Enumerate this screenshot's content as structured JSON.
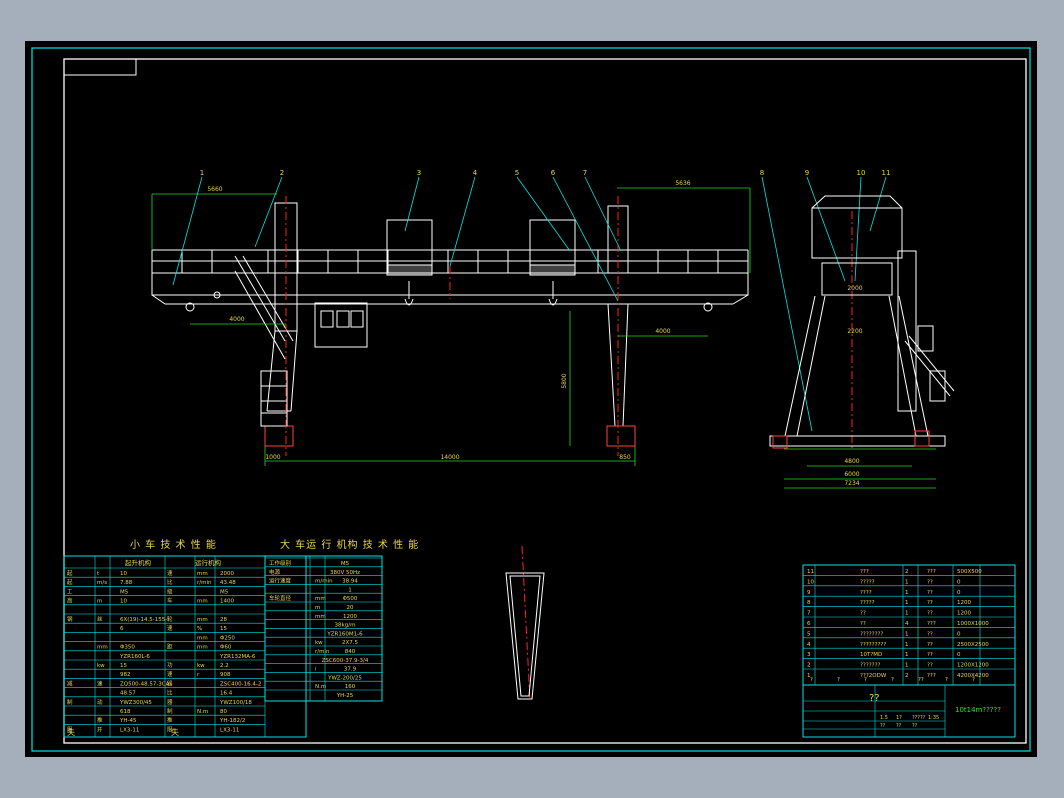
{
  "colors": {
    "background": "#a5aebb",
    "sheet": "#000000",
    "line_cyan": "#00e5e5",
    "structure": "#ffffff",
    "center_line": "#ff2020",
    "text_yellow": "#e8d44a",
    "text_green": "#33e033",
    "dim_green": "#22dd22"
  },
  "balloons": [
    "1",
    "2",
    "3",
    "4",
    "5",
    "6",
    "7",
    "8",
    "9",
    "10",
    "11"
  ],
  "dimensions": {
    "left_overhang": "5660",
    "right_overhang": "5636",
    "hook_left": "4000",
    "hook_right": "4000",
    "lift_height": "5800",
    "span": "14000",
    "leg_left": "1000",
    "leg_right": "850",
    "trolley_gauge": "2000",
    "side_width_inner": "2200",
    "side_4800": "4800",
    "side_6000": "6000",
    "side_total": "7234"
  },
  "table_titles": {
    "trolley": "小 车 技 术 性 能",
    "crane": "大 车运 行 机构 技 术 性 能"
  },
  "trolley_table": {
    "header": [
      "起升机构",
      "运行机构"
    ],
    "rows": [
      [
        "起",
        "t",
        "10",
        "速",
        "mm",
        "2000"
      ],
      [
        "起",
        "m/s",
        "7.88",
        "比",
        "r/min",
        "43.48"
      ],
      [
        "工",
        "",
        "M5",
        "级",
        "",
        "M5"
      ],
      [
        "高",
        "m",
        "10",
        "车",
        "mm",
        "1400"
      ],
      [
        "",
        "",
        "",
        "",
        "",
        ""
      ],
      [
        "钢",
        "丝",
        "6X(19)-14.5-155-Ⅰ",
        "轮",
        "mm",
        "28"
      ],
      [
        "",
        "",
        "6",
        "速",
        "%",
        "15"
      ],
      [
        "",
        "",
        "",
        "",
        "mm",
        "Φ250"
      ],
      [
        "",
        "mm",
        "Φ350",
        "距",
        "mm",
        "Φ60"
      ],
      [
        "",
        "",
        "YZR160L-6",
        "",
        "",
        "YZR132MA-6"
      ],
      [
        "",
        "kw",
        "15",
        "功",
        "kw",
        "2.2"
      ],
      [
        "",
        "",
        "982",
        "速",
        "r",
        "908"
      ],
      [
        "减",
        "速",
        "ZQ500-48.57-3CA",
        "器",
        "",
        "ZSC400-16.4-2"
      ],
      [
        "",
        "",
        "48.57",
        "比",
        "",
        "16.4"
      ],
      [
        "制",
        "动",
        "YWZ300/45",
        "器",
        "",
        "YWZ100/18"
      ],
      [
        "",
        "",
        "618",
        "制",
        "N.m",
        "80"
      ],
      [
        "",
        "推",
        "YH-45",
        "推",
        "",
        "YH-182/2"
      ],
      [
        "限",
        "开",
        "LX3-11",
        "限",
        "",
        "LX3-11"
      ]
    ]
  },
  "crane_table": {
    "rows": [
      [
        "工作级别",
        "M5"
      ],
      [
        "电源",
        "380V 50Hz"
      ],
      [
        "运行速度",
        "m/min",
        "38.94"
      ],
      [
        "",
        "",
        "1"
      ],
      [
        "车轮直径",
        "mm",
        "Φ500"
      ],
      [
        "",
        "m",
        "20"
      ],
      [
        "",
        "mm",
        "1200"
      ],
      [
        "",
        "38kg/m"
      ],
      [
        "",
        "YZR160M1-6"
      ],
      [
        "",
        "kw",
        "2X7.5"
      ],
      [
        "",
        "r/min",
        "840"
      ],
      [
        "",
        "ZSC600-37.9-3/4"
      ],
      [
        "",
        "i",
        "37.9"
      ],
      [
        "",
        "YWZ-200/25"
      ],
      [
        "",
        "N.m",
        "160"
      ],
      [
        "",
        "YH-25"
      ]
    ]
  },
  "parts_list": [
    [
      "11",
      "???",
      "2",
      "???",
      "500X500"
    ],
    [
      "10",
      "?????",
      "1",
      "??",
      "0"
    ],
    [
      "9",
      "????",
      "1",
      "??",
      "0"
    ],
    [
      "8",
      "?????",
      "1",
      "??",
      "1200"
    ],
    [
      "7",
      "??",
      "1",
      "??",
      "1200"
    ],
    [
      "6",
      "??",
      "4",
      "???",
      "1000X1000"
    ],
    [
      "5",
      "????????",
      "1",
      "??",
      "0"
    ],
    [
      "4",
      "?????????",
      "1",
      "??",
      "2500X2500"
    ],
    [
      "3",
      "10T?MD",
      "1",
      "??",
      "0"
    ],
    [
      "2",
      "???????",
      "1",
      "??",
      "1200X1200"
    ],
    [
      "1",
      "???2ODW",
      "2",
      "???",
      "4200X4200"
    ]
  ],
  "parts_header": [
    "?",
    "?",
    "?",
    "?",
    "??",
    "?",
    "?"
  ],
  "title_block": {
    "title_center": "??",
    "drawing_name": "10t14m?????",
    "notes": [
      "1.5",
      "1?",
      "?????",
      "1:35",
      "??",
      "??",
      "??"
    ]
  },
  "labels": {
    "left_bottom_1": "失",
    "left_bottom_2": "失"
  }
}
